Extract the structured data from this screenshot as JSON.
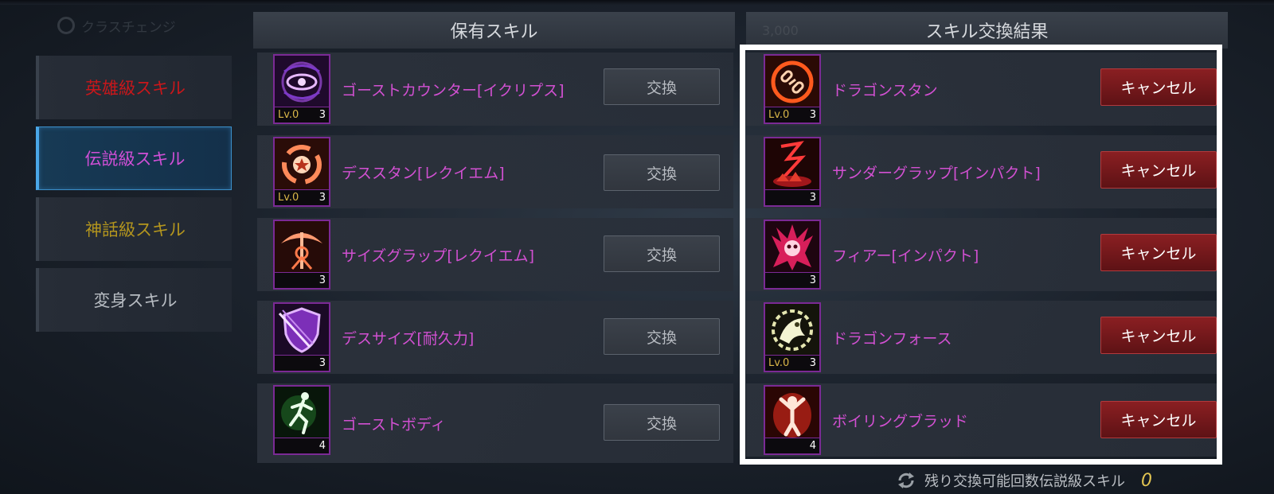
{
  "top": {
    "faded_tab": "クラスチェンジ"
  },
  "categories": [
    {
      "label": "英雄級スキル",
      "color": "#c8171b"
    },
    {
      "label": "伝説級スキル",
      "color": "#d04fd6"
    },
    {
      "label": "神話級スキル",
      "color": "#b3951e"
    },
    {
      "label": "変身スキル",
      "color": "#b7bcc2"
    }
  ],
  "owned": {
    "title": "保有スキル",
    "exchange_label": "交換",
    "items": [
      {
        "name": "ゴーストカウンター[イクリプス]",
        "level": "Lv.0",
        "count": "3",
        "icon": "ghost-eye-icon"
      },
      {
        "name": "デススタン[レクイエム]",
        "level": "Lv.0",
        "count": "3",
        "icon": "death-stun-icon"
      },
      {
        "name": "サイズグラップ[レクイエム]",
        "level": "",
        "count": "3",
        "icon": "scythe-grab-icon"
      },
      {
        "name": "デスサイズ[耐久力]",
        "level": "",
        "count": "3",
        "icon": "shield-slash-icon"
      },
      {
        "name": "ゴーストボディ",
        "level": "",
        "count": "4",
        "icon": "ghost-body-icon"
      }
    ]
  },
  "results": {
    "title": "スキル交換結果",
    "ghost_text": "3,000",
    "cancel_label": "キャンセル",
    "items": [
      {
        "name": "ドラゴンスタン",
        "level": "Lv.0",
        "count": "3",
        "icon": "dragon-chain-icon"
      },
      {
        "name": "サンダーグラップ[インパクト]",
        "level": "",
        "count": "3",
        "icon": "thunder-icon"
      },
      {
        "name": "フィアー[インパクト]",
        "level": "",
        "count": "3",
        "icon": "fear-skull-icon"
      },
      {
        "name": "ドラゴンフォース",
        "level": "Lv.0",
        "count": "3",
        "icon": "dragon-force-icon"
      },
      {
        "name": "ボイリングブラッド",
        "level": "",
        "count": "4",
        "icon": "boiling-blood-icon"
      }
    ]
  },
  "footer": {
    "label": "残り交換可能回数伝説級スキル",
    "value": "0"
  }
}
